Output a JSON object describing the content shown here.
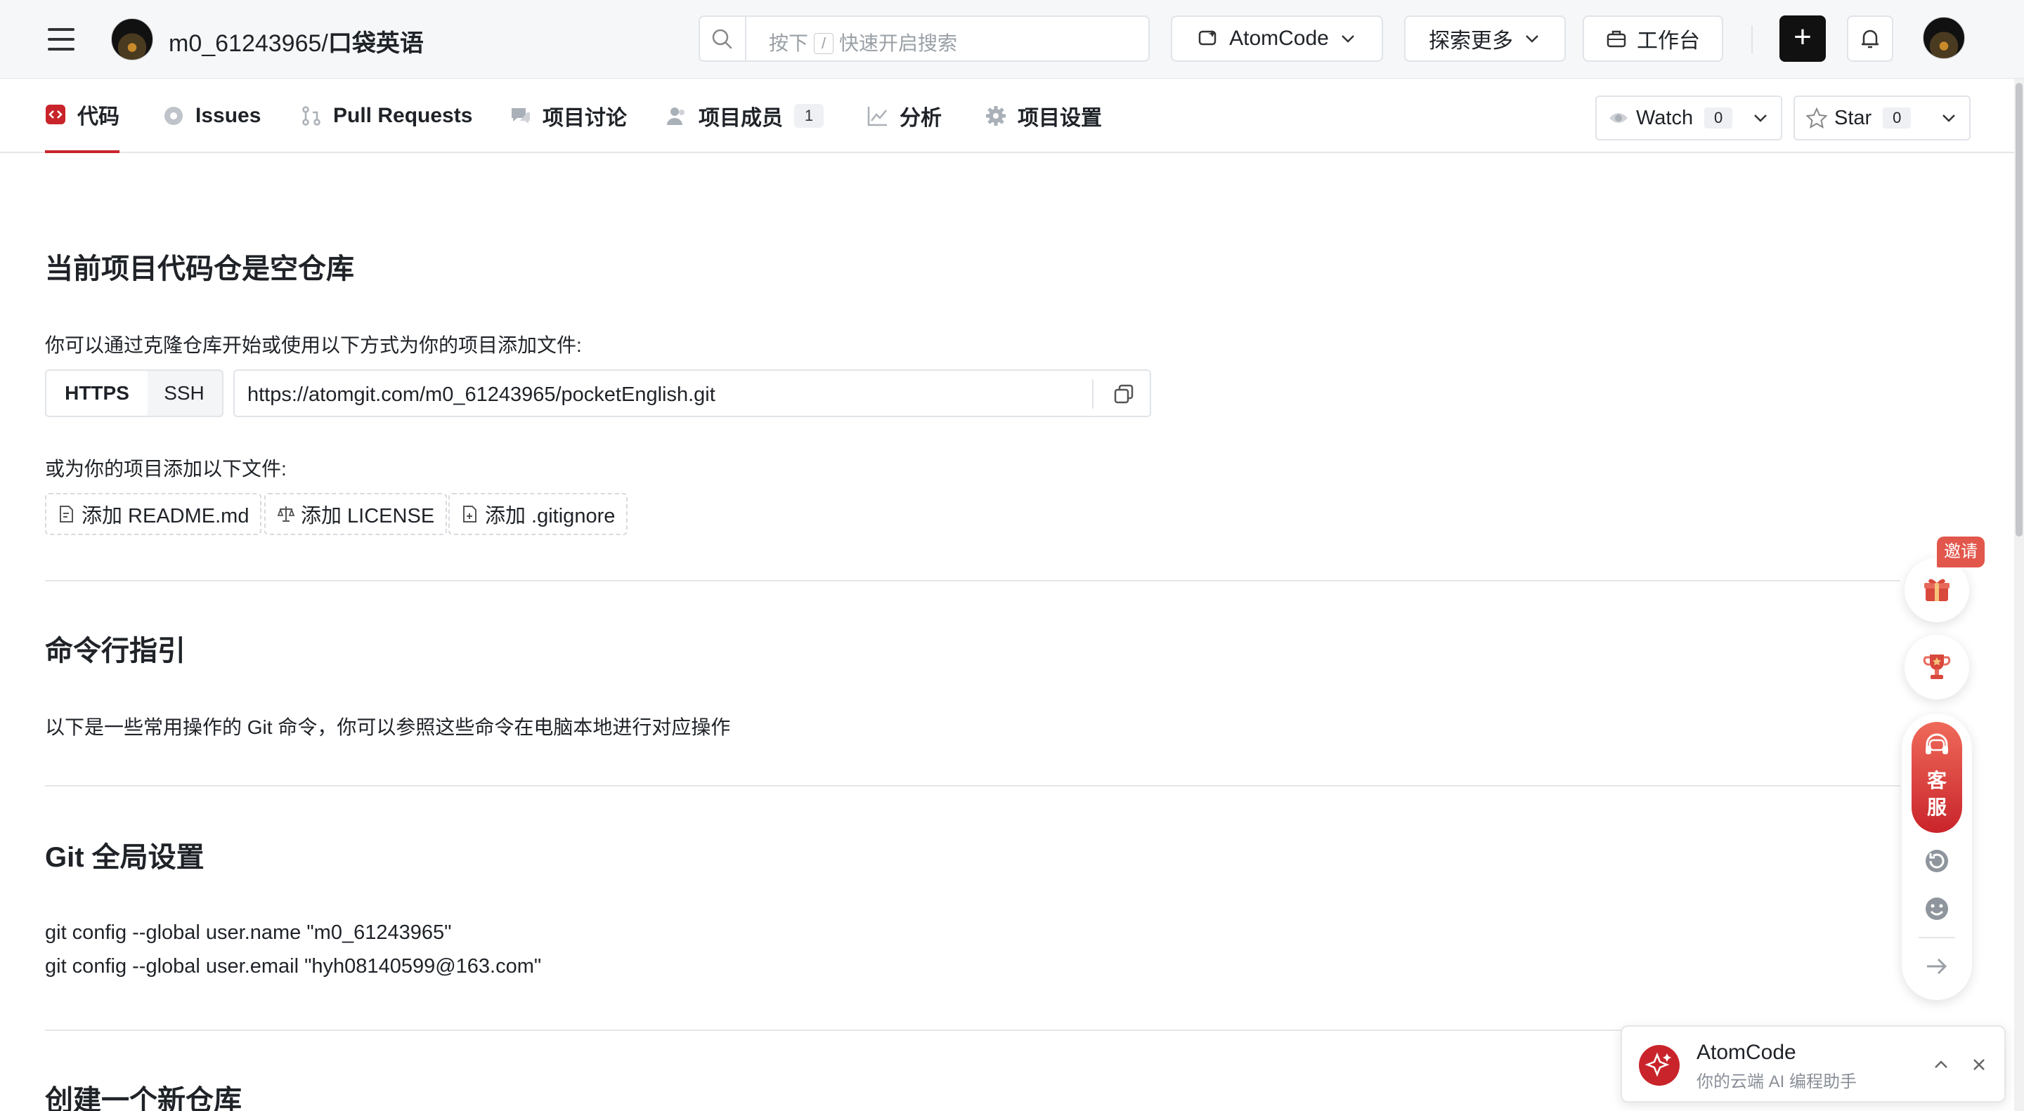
{
  "header": {
    "owner": "m0_61243965/",
    "repo_name": "口袋英语",
    "search": {
      "prefix": "按下",
      "key": "/",
      "suffix": "快速开启搜索"
    },
    "atomcode_label": "AtomCode",
    "explore_label": "探索更多",
    "workbench_label": "工作台",
    "plus_label": "+"
  },
  "tabs": [
    {
      "label": "代码",
      "icon": "code-icon",
      "active": true
    },
    {
      "label": "Issues",
      "icon": "issue-icon"
    },
    {
      "label": "Pull Requests",
      "icon": "pull-request-icon"
    },
    {
      "label": "项目讨论",
      "icon": "discussion-icon"
    },
    {
      "label": "项目成员",
      "icon": "members-icon",
      "count": "1"
    },
    {
      "label": "分析",
      "icon": "chart-icon"
    },
    {
      "label": "项目设置",
      "icon": "gear-icon"
    }
  ],
  "watch": {
    "label": "Watch",
    "count": "0"
  },
  "star": {
    "label": "Star",
    "count": "0"
  },
  "main": {
    "empty_title": "当前项目代码仓是空仓库",
    "clone_hint": "你可以通过克隆仓库开始或使用以下方式为你的项目添加文件:",
    "protocols": [
      "HTTPS",
      "SSH"
    ],
    "active_protocol": "HTTPS",
    "clone_url": "https://atomgit.com/m0_61243965/pocketEnglish.git",
    "add_files_hint": "或为你的项目添加以下文件:",
    "add_buttons": [
      "添加 README.md",
      "添加 LICENSE",
      "添加 .gitignore"
    ],
    "cli_title": "命令行指引",
    "cli_desc": "以下是一些常用操作的 Git 命令，你可以参照这些命令在电脑本地进行对应操作",
    "git_global_title": "Git 全局设置",
    "git_global_cmds": [
      "git config --global user.name \"m0_61243965\"",
      "git config --global user.email \"hyh08140599@163.com\""
    ],
    "new_repo_title": "创建一个新仓库"
  },
  "floating": {
    "invite_label": "邀请",
    "kefu_line1": "客",
    "kefu_line2": "服"
  },
  "toast": {
    "title": "AtomCode",
    "subtitle": "你的云端 AI 编程助手"
  },
  "colors": {
    "accent": "#c9242b",
    "text": "#1f2328",
    "border": "#e1e4e8"
  }
}
